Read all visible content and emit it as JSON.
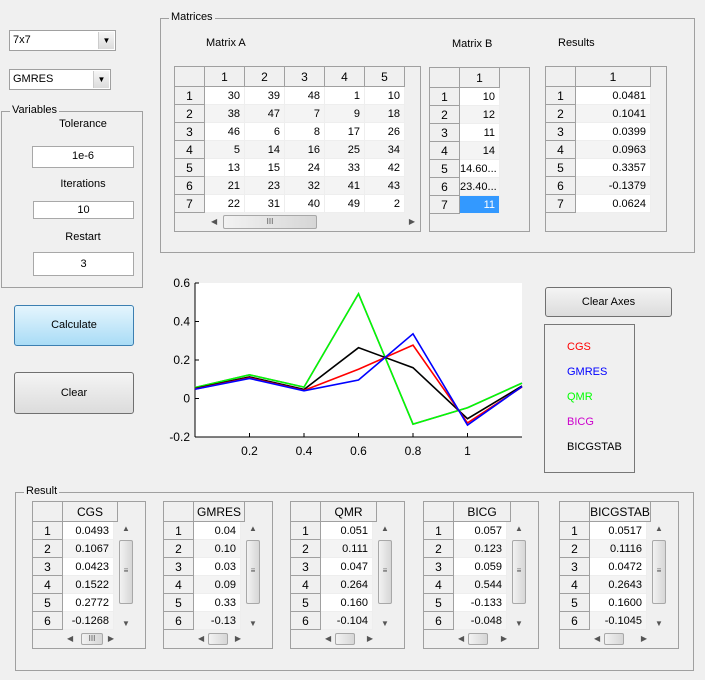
{
  "controls": {
    "size_select": "7x7",
    "method_select": "GMRES"
  },
  "variables": {
    "title": "Variables",
    "tolerance_label": "Tolerance",
    "tolerance": "1e-6",
    "iterations_label": "Iterations",
    "iterations": "10",
    "restart_label": "Restart",
    "restart": "3"
  },
  "buttons": {
    "calculate": "Calculate",
    "clear": "Clear",
    "clear_axes": "Clear Axes"
  },
  "matrices": {
    "title": "Matrices",
    "matrix_a_label": "Matrix A",
    "matrix_b_label": "Matrix B",
    "results_label": "Results",
    "matrix_a": {
      "columns": [
        "1",
        "2",
        "3",
        "4",
        "5"
      ],
      "rows": [
        "1",
        "2",
        "3",
        "4",
        "5",
        "6",
        "7"
      ],
      "values": [
        [
          "30",
          "39",
          "48",
          "1",
          "10"
        ],
        [
          "38",
          "47",
          "7",
          "9",
          "18"
        ],
        [
          "46",
          "6",
          "8",
          "17",
          "26"
        ],
        [
          "5",
          "14",
          "16",
          "25",
          "34"
        ],
        [
          "13",
          "15",
          "24",
          "33",
          "42"
        ],
        [
          "21",
          "23",
          "32",
          "41",
          "43"
        ],
        [
          "22",
          "31",
          "40",
          "49",
          "2"
        ]
      ]
    },
    "matrix_b": {
      "columns": [
        "1"
      ],
      "rows": [
        "1",
        "2",
        "3",
        "4",
        "5",
        "6",
        "7"
      ],
      "values": [
        [
          "10"
        ],
        [
          "12"
        ],
        [
          "11"
        ],
        [
          "14"
        ],
        [
          "14.60..."
        ],
        [
          "23.40..."
        ],
        [
          "11"
        ]
      ],
      "selected_row": 6
    },
    "results": {
      "columns": [
        "1"
      ],
      "rows": [
        "1",
        "2",
        "3",
        "4",
        "5",
        "6",
        "7"
      ],
      "values": [
        [
          "0.0481"
        ],
        [
          "0.1041"
        ],
        [
          "0.0399"
        ],
        [
          "0.0963"
        ],
        [
          "0.3357"
        ],
        [
          "-0.1379"
        ],
        [
          "0.0624"
        ]
      ]
    }
  },
  "result": {
    "title": "Result",
    "tables": [
      {
        "column": "CGS",
        "rows": [
          "1",
          "2",
          "3",
          "4",
          "5",
          "6"
        ],
        "values": [
          "0.0493",
          "0.1067",
          "0.0423",
          "0.1522",
          "0.2772",
          "-0.1268"
        ]
      },
      {
        "column": "GMRES",
        "rows": [
          "1",
          "2",
          "3",
          "4",
          "5",
          "6"
        ],
        "values": [
          "0.04",
          "0.10",
          "0.03",
          "0.09",
          "0.33",
          "-0.13"
        ]
      },
      {
        "column": "QMR",
        "rows": [
          "1",
          "2",
          "3",
          "4",
          "5",
          "6"
        ],
        "values": [
          "0.051",
          "0.111",
          "0.047",
          "0.264",
          "0.160",
          "-0.104"
        ]
      },
      {
        "column": "BICG",
        "rows": [
          "1",
          "2",
          "3",
          "4",
          "5",
          "6"
        ],
        "values": [
          "0.057",
          "0.123",
          "0.059",
          "0.544",
          "-0.133",
          "-0.048"
        ]
      },
      {
        "column": "BICGSTAB",
        "rows": [
          "1",
          "2",
          "3",
          "4",
          "5",
          "6"
        ],
        "values": [
          "0.0517",
          "0.1116",
          "0.0472",
          "0.2643",
          "0.1600",
          "-0.1045"
        ]
      }
    ]
  },
  "chart_data": {
    "type": "line",
    "xlim": [
      0,
      1.2
    ],
    "ylim": [
      -0.2,
      0.6
    ],
    "grid": false,
    "legend_placement": "right (separate box)",
    "x": [
      0,
      0.2,
      0.4,
      0.6,
      0.8,
      1.0,
      1.2
    ],
    "xticks": [
      "0.2",
      "0.4",
      "0.6",
      "0.8",
      "1"
    ],
    "xtick_values": [
      0.2,
      0.4,
      0.6,
      0.8,
      1
    ],
    "yticks": [
      "0.6",
      "0.4",
      "0.2",
      "0",
      "-0.2"
    ],
    "ytick_values": [
      0.6,
      0.4,
      0.2,
      0,
      -0.2
    ],
    "series": [
      {
        "name": "CGS",
        "color": "#ff0000",
        "values": [
          0.049,
          0.107,
          0.042,
          0.152,
          0.277,
          -0.127,
          0.06
        ]
      },
      {
        "name": "GMRES",
        "color": "#0000ff",
        "values": [
          0.048,
          0.104,
          0.04,
          0.096,
          0.336,
          -0.138,
          0.062
        ]
      },
      {
        "name": "QMR",
        "color": "#00ff00",
        "values": [
          0.057,
          0.123,
          0.059,
          0.544,
          -0.133,
          -0.048,
          0.08
        ]
      },
      {
        "name": "BICG",
        "color": "#cc00cc",
        "values": [
          0.057,
          0.123,
          0.059,
          0.544,
          -0.133,
          -0.048,
          0.08
        ]
      },
      {
        "name": "BICGSTAB",
        "color": "#000000",
        "values": [
          0.052,
          0.112,
          0.047,
          0.264,
          0.16,
          -0.105,
          0.065
        ]
      }
    ]
  }
}
